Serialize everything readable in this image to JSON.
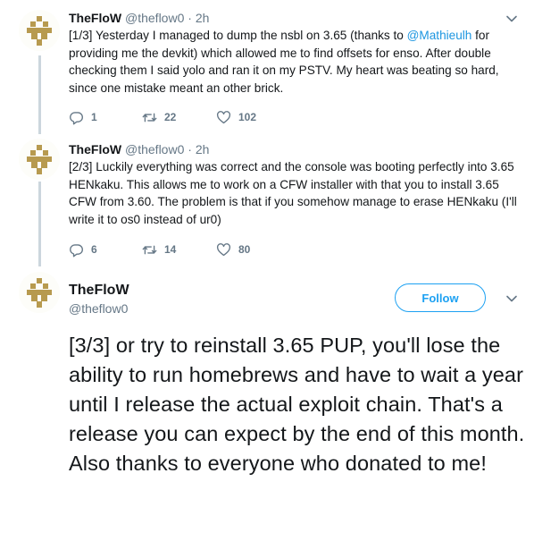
{
  "tweets": [
    {
      "name": "TheFloW",
      "handle": "@theflow0",
      "dot": "·",
      "time": "2h",
      "text_before": "[1/3] Yesterday I managed to dump the nsbl on 3.65 (thanks to ",
      "mention": "@Mathieulh",
      "text_after": " for providing me the devkit) which allowed me to find offsets for enso. After double checking them I said yolo and ran it on my PSTV. My heart was beating so hard, since one mistake meant an other brick.",
      "replies": "1",
      "retweets": "22",
      "likes": "102"
    },
    {
      "name": "TheFloW",
      "handle": "@theflow0",
      "dot": "·",
      "time": "2h",
      "text": "[2/3] Luckily everything was correct and the console was booting perfectly into 3.65 HENkaku. This allows me to work on a CFW installer with that you to install 3.65 CFW from 3.60. The problem is that if you somehow manage to erase HENkaku (I'll write it to os0 instead of ur0)",
      "replies": "6",
      "retweets": "14",
      "likes": "80"
    }
  ],
  "main_tweet": {
    "name": "TheFloW",
    "handle": "@theflow0",
    "follow_label": "Follow",
    "text": "[3/3] or try to reinstall 3.65 PUP, you'll lose the ability to run homebrews and have to wait a year until I release the actual exploit chain. That's a release you can expect by the end of this month. Also thanks to everyone who donated to me!"
  },
  "colors": {
    "link": "#1b95e0",
    "follow": "#1da1f2",
    "muted": "#657786",
    "thread_line": "#ccd6dd",
    "avatar_gold": "#b79a4f"
  },
  "icons": [
    "avatar-logo",
    "chevron-down-icon",
    "reply-icon",
    "retweet-icon",
    "like-icon"
  ]
}
